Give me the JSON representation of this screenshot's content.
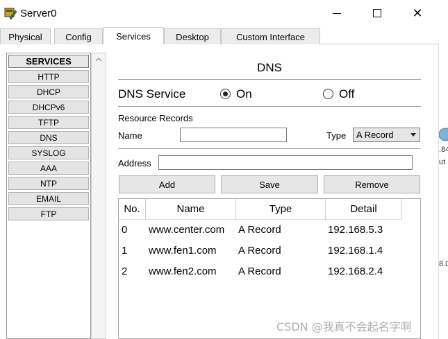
{
  "window": {
    "title": "Server0",
    "minimize_glyph": "",
    "close_glyph": "✕"
  },
  "tabs": [
    {
      "label": "Physical"
    },
    {
      "label": "Config"
    },
    {
      "label": "Services"
    },
    {
      "label": "Desktop"
    },
    {
      "label": "Custom Interface"
    }
  ],
  "active_tab": "Services",
  "services": {
    "header": "SERVICES",
    "items": [
      "HTTP",
      "DHCP",
      "DHCPv6",
      "TFTP",
      "DNS",
      "SYSLOG",
      "AAA",
      "NTP",
      "EMAIL",
      "FTP"
    ]
  },
  "dns": {
    "title": "DNS",
    "service_label": "DNS Service",
    "on_label": "On",
    "off_label": "Off",
    "service_state": "On",
    "resource_records_label": "Resource Records",
    "name_label": "Name",
    "name_value": "",
    "type_label": "Type",
    "type_value": "A Record",
    "address_label": "Address",
    "address_value": "",
    "buttons": {
      "add": "Add",
      "save": "Save",
      "remove": "Remove"
    },
    "table": {
      "headers": [
        "No.",
        "Name",
        "Type",
        "Detail"
      ],
      "rows": [
        {
          "no": "0",
          "name": "www.center.com",
          "type": "A Record",
          "detail": "192.168.5.3"
        },
        {
          "no": "1",
          "name": "www.fen1.com",
          "type": "A Record",
          "detail": "192.168.1.4"
        },
        {
          "no": "2",
          "name": "www.fen2.com",
          "type": "A Record",
          "detail": "192.168.2.4"
        }
      ]
    }
  },
  "right_edge": {
    "glyphs": [
      ".84",
      "ut",
      "8.0"
    ]
  },
  "watermark": "CSDN @我真不会起名字啊"
}
